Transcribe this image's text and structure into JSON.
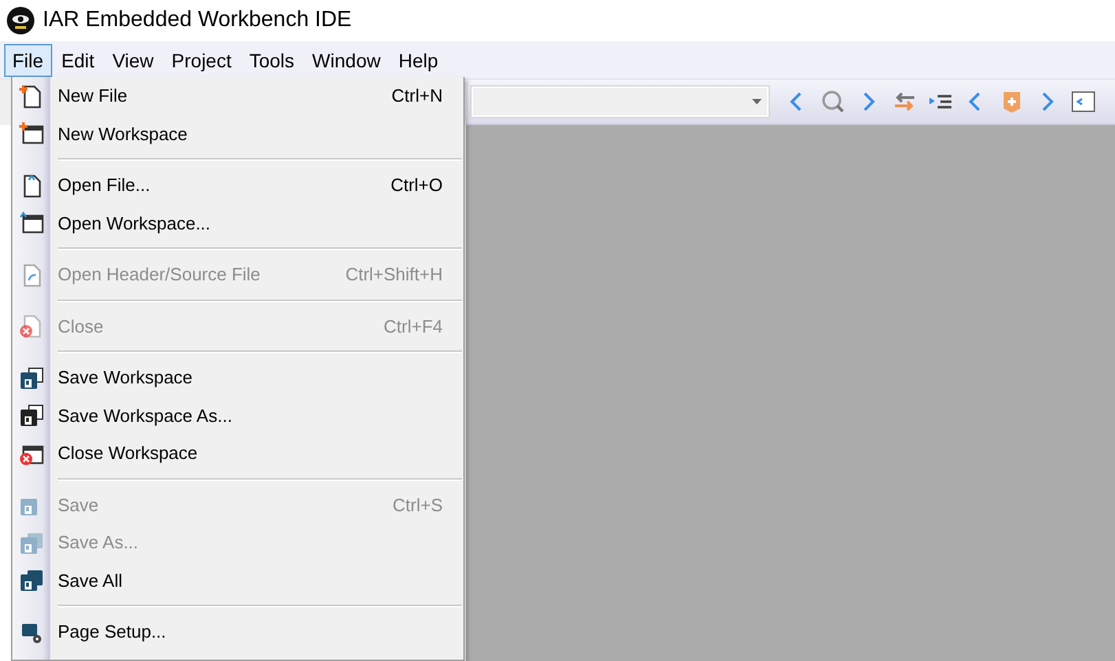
{
  "window": {
    "title": "IAR Embedded Workbench IDE"
  },
  "menubar": [
    {
      "label": "File",
      "selected": true
    },
    {
      "label": "Edit",
      "selected": false
    },
    {
      "label": "View",
      "selected": false
    },
    {
      "label": "Project",
      "selected": false
    },
    {
      "label": "Tools",
      "selected": false
    },
    {
      "label": "Window",
      "selected": false
    },
    {
      "label": "Help",
      "selected": false
    }
  ],
  "file_menu": [
    {
      "kind": "item",
      "label": "New File",
      "shortcut": "Ctrl+N",
      "disabled": false
    },
    {
      "kind": "item",
      "label": "New Workspace",
      "disabled": false
    },
    {
      "kind": "separator"
    },
    {
      "kind": "item",
      "label": "Open File...",
      "shortcut": "Ctrl+O",
      "disabled": false
    },
    {
      "kind": "item",
      "label": "Open Workspace...",
      "disabled": false
    },
    {
      "kind": "separator"
    },
    {
      "kind": "item",
      "label": "Open Header/Source File",
      "shortcut": "Ctrl+Shift+H",
      "disabled": true
    },
    {
      "kind": "separator"
    },
    {
      "kind": "item",
      "label": "Close",
      "shortcut": "Ctrl+F4",
      "disabled": true
    },
    {
      "kind": "separator"
    },
    {
      "kind": "item",
      "label": "Save Workspace",
      "disabled": false
    },
    {
      "kind": "item",
      "label": "Save Workspace As...",
      "disabled": false
    },
    {
      "kind": "item",
      "label": "Close Workspace",
      "disabled": false
    },
    {
      "kind": "separator"
    },
    {
      "kind": "item",
      "label": "Save",
      "shortcut": "Ctrl+S",
      "disabled": true
    },
    {
      "kind": "item",
      "label": "Save As...",
      "disabled": true
    },
    {
      "kind": "item",
      "label": "Save All",
      "disabled": false
    },
    {
      "kind": "separator"
    },
    {
      "kind": "item",
      "label": "Page Setup...",
      "disabled": false
    }
  ]
}
